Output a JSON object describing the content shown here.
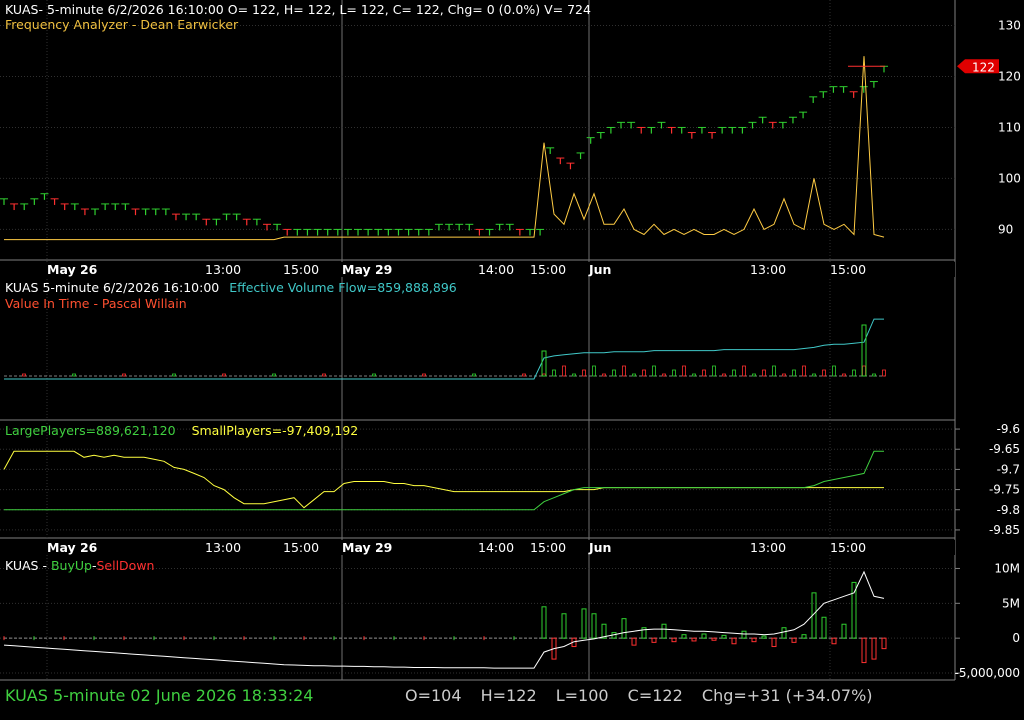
{
  "colors": {
    "bg": "#000000",
    "grid": "#404040",
    "up": "#30d030",
    "down": "#ff3030",
    "price_line": "#ffcc44",
    "teal": "#40c8c8",
    "yellow": "#ffff40",
    "green": "#40d040",
    "white": "#ffffff"
  },
  "panel1": {
    "header": "KUAS- 5-minute 6/2/2026 16:10:00 O= 122, H= 122, L= 122, C= 122, Chg= 0 (0.0%) V= 724",
    "indicator": "Frequency Analyzer - Dean Earwicker",
    "last_price_tag": "122"
  },
  "panel2": {
    "header_prefix": "KUAS 5-minute  6/2/2026 16:10:00",
    "header_indicator": "Effective Volume Flow=859,888,896",
    "subtitle": "Value In Time - Pascal Willain"
  },
  "panel3": {
    "large": "LargePlayers=889,621,120",
    "small": "SmallPlayers=-97,409,192"
  },
  "panel4": {
    "symbol": "KUAS - ",
    "buy": "BuyUp",
    "dash": "-",
    "sell": "SellDown"
  },
  "time_axis": [
    "May 26",
    "13:00",
    "15:00",
    "May 29",
    "14:00",
    "15:00",
    "Jun",
    "13:00",
    "15:00"
  ],
  "status_bar": {
    "left": "KUAS  5-minute   02 June 2026 18:33:24",
    "open": "O=104",
    "high": "H=122",
    "low": "L=100",
    "close": "C=122",
    "change": "Chg=+31 (+34.07%)"
  },
  "chart_data": [
    {
      "type": "line",
      "name": "price-panel",
      "y_ticks": [
        "130",
        "120",
        "110",
        "100",
        "90"
      ],
      "ylim": [
        84,
        135
      ],
      "price_bars": [
        96,
        95,
        95,
        96,
        97,
        96,
        95,
        95,
        94,
        94,
        95,
        95,
        95,
        94,
        94,
        94,
        94,
        93,
        93,
        93,
        92,
        92,
        93,
        93,
        92,
        92,
        91,
        91,
        90,
        90,
        90,
        90,
        90,
        90,
        90,
        90,
        90,
        90,
        90,
        90,
        90,
        90,
        90,
        91,
        91,
        91,
        91,
        90,
        90,
        91,
        91,
        90,
        90,
        90,
        106,
        104,
        103,
        105,
        108,
        109,
        110,
        111,
        111,
        110,
        110,
        111,
        110,
        110,
        109,
        110,
        109,
        110,
        110,
        110,
        111,
        112,
        111,
        111,
        112,
        113,
        116,
        117,
        118,
        118,
        117,
        118,
        119,
        122
      ],
      "frequency_line": [
        88,
        88,
        88,
        88,
        88,
        88,
        88,
        88,
        88,
        88,
        88,
        88,
        88,
        88,
        88,
        88,
        88,
        88,
        88,
        88,
        88,
        88,
        88,
        88,
        88,
        88,
        88,
        88,
        88.5,
        88.5,
        88.5,
        88.5,
        88.5,
        88.5,
        88.5,
        88.5,
        88.5,
        88.5,
        88.5,
        88.5,
        88.5,
        88.5,
        88.5,
        88.5,
        88.5,
        88.5,
        88.5,
        88.5,
        88.5,
        88.5,
        88.5,
        88.5,
        88.5,
        88.5,
        107,
        93,
        91,
        97,
        92,
        97,
        91,
        91,
        94,
        90,
        89,
        91,
        89,
        90,
        89,
        90,
        89,
        89,
        90,
        89,
        90,
        94,
        90,
        91,
        96,
        91,
        90,
        100,
        91,
        90,
        91,
        89,
        124,
        89,
        88.5
      ]
    },
    {
      "type": "line",
      "name": "effective-volume-flow",
      "evf": [
        0,
        0,
        0,
        0,
        0,
        0,
        0,
        0,
        0,
        0,
        0,
        0,
        0,
        0,
        0,
        0,
        0,
        0,
        0,
        0,
        0,
        0,
        0,
        0,
        0,
        0,
        0,
        0,
        0,
        0,
        0,
        0,
        0,
        0,
        0,
        0,
        0,
        0,
        0,
        0,
        0,
        0,
        0,
        0,
        0,
        0,
        0,
        0,
        0,
        0,
        0,
        0,
        0,
        0,
        20,
        22,
        23,
        24,
        25,
        25,
        25,
        26,
        26,
        26,
        26,
        27,
        27,
        27,
        27,
        27,
        27,
        27,
        28,
        28,
        28,
        28,
        28,
        28,
        28,
        28,
        29,
        30,
        32,
        33,
        33,
        34,
        35,
        57,
        57
      ]
    },
    {
      "type": "line",
      "name": "large-small-players",
      "y_ticks": [
        "-9.6",
        "-9.65",
        "-9.7",
        "-9.75",
        "-9.8",
        "-9.85"
      ],
      "ylim": [
        -9.87,
        -9.58
      ],
      "large_players": [
        -9.8,
        -9.8,
        -9.8,
        -9.8,
        -9.8,
        -9.8,
        -9.8,
        -9.8,
        -9.8,
        -9.8,
        -9.8,
        -9.8,
        -9.8,
        -9.8,
        -9.8,
        -9.8,
        -9.8,
        -9.8,
        -9.8,
        -9.8,
        -9.8,
        -9.8,
        -9.8,
        -9.8,
        -9.8,
        -9.8,
        -9.8,
        -9.8,
        -9.8,
        -9.8,
        -9.8,
        -9.8,
        -9.8,
        -9.8,
        -9.8,
        -9.8,
        -9.8,
        -9.8,
        -9.8,
        -9.8,
        -9.8,
        -9.8,
        -9.8,
        -9.8,
        -9.8,
        -9.8,
        -9.8,
        -9.8,
        -9.8,
        -9.8,
        -9.8,
        -9.8,
        -9.8,
        -9.8,
        -9.78,
        -9.77,
        -9.76,
        -9.75,
        -9.745,
        -9.745,
        -9.745,
        -9.745,
        -9.745,
        -9.745,
        -9.745,
        -9.745,
        -9.745,
        -9.745,
        -9.745,
        -9.745,
        -9.745,
        -9.745,
        -9.745,
        -9.745,
        -9.745,
        -9.745,
        -9.745,
        -9.745,
        -9.745,
        -9.745,
        -9.745,
        -9.74,
        -9.73,
        -9.725,
        -9.72,
        -9.715,
        -9.71,
        -9.655,
        -9.655
      ],
      "small_players": [
        -9.7,
        -9.655,
        -9.655,
        -9.655,
        -9.655,
        -9.655,
        -9.655,
        -9.655,
        -9.67,
        -9.665,
        -9.67,
        -9.665,
        -9.67,
        -9.67,
        -9.67,
        -9.675,
        -9.68,
        -9.695,
        -9.7,
        -9.71,
        -9.72,
        -9.74,
        -9.75,
        -9.77,
        -9.785,
        -9.785,
        -9.785,
        -9.78,
        -9.775,
        -9.77,
        -9.795,
        -9.775,
        -9.755,
        -9.755,
        -9.735,
        -9.73,
        -9.73,
        -9.73,
        -9.73,
        -9.735,
        -9.735,
        -9.74,
        -9.74,
        -9.745,
        -9.75,
        -9.755,
        -9.755,
        -9.755,
        -9.755,
        -9.755,
        -9.755,
        -9.755,
        -9.755,
        -9.755,
        -9.755,
        -9.755,
        -9.755,
        -9.75,
        -9.75,
        -9.75,
        -9.745,
        -9.745,
        -9.745,
        -9.745,
        -9.745,
        -9.745,
        -9.745,
        -9.745,
        -9.745,
        -9.745,
        -9.745,
        -9.745,
        -9.745,
        -9.745,
        -9.745,
        -9.745,
        -9.745,
        -9.745,
        -9.745,
        -9.745,
        -9.745,
        -9.745,
        -9.745,
        -9.745,
        -9.745,
        -9.745,
        -9.745,
        -9.745,
        -9.745
      ]
    },
    {
      "type": "bar",
      "name": "buyup-selldown",
      "y_ticks": [
        "10M",
        "5M",
        "0",
        "-5,000,000"
      ],
      "ylim": [
        -6000000,
        11500000
      ],
      "buy_sell": [
        0,
        0,
        0,
        0,
        0,
        0,
        0,
        0,
        0,
        0,
        0,
        0,
        0,
        0,
        0,
        0,
        0,
        0,
        0,
        0,
        0,
        0,
        0,
        0,
        0,
        0,
        0,
        0,
        0,
        0,
        0,
        0,
        0,
        0,
        0,
        0,
        0,
        0,
        0,
        0,
        0,
        0,
        0,
        0,
        0,
        0,
        0,
        0,
        0,
        0,
        0,
        0,
        0,
        0,
        4500000,
        -3000000,
        3500000,
        -1200000,
        4200000,
        3500000,
        2000000,
        800000,
        2800000,
        -1000000,
        1500000,
        -600000,
        2000000,
        -500000,
        500000,
        -400000,
        600000,
        -300000,
        400000,
        -800000,
        1000000,
        -500000,
        300000,
        -1200000,
        1500000,
        -600000,
        500000,
        6500000,
        3000000,
        -800000,
        2000000,
        8000000,
        -3500000,
        -3000000,
        -1500000
      ],
      "cumulative": [
        -1000000,
        -1100000,
        -1200000,
        -1300000,
        -1400000,
        -1500000,
        -1600000,
        -1700000,
        -1800000,
        -1900000,
        -2000000,
        -2100000,
        -2200000,
        -2300000,
        -2400000,
        -2500000,
        -2600000,
        -2700000,
        -2800000,
        -2900000,
        -3000000,
        -3100000,
        -3200000,
        -3300000,
        -3400000,
        -3500000,
        -3600000,
        -3700000,
        -3800000,
        -3850000,
        -3900000,
        -3950000,
        -3950000,
        -4000000,
        -4000000,
        -4050000,
        -4050000,
        -4100000,
        -4100000,
        -4150000,
        -4150000,
        -4200000,
        -4200000,
        -4200000,
        -4250000,
        -4250000,
        -4250000,
        -4250000,
        -4250000,
        -4300000,
        -4300000,
        -4300000,
        -4300000,
        -4300000,
        -2000000,
        -1500000,
        -1200000,
        -500000,
        -300000,
        -100000,
        200000,
        500000,
        800000,
        1000000,
        1200000,
        1300000,
        1300000,
        1200000,
        1100000,
        1000000,
        1000000,
        900000,
        800000,
        700000,
        600000,
        600000,
        500000,
        600000,
        900000,
        1200000,
        2000000,
        3500000,
        5000000,
        5500000,
        6000000,
        6500000,
        9500000,
        6000000,
        5700000
      ]
    }
  ]
}
